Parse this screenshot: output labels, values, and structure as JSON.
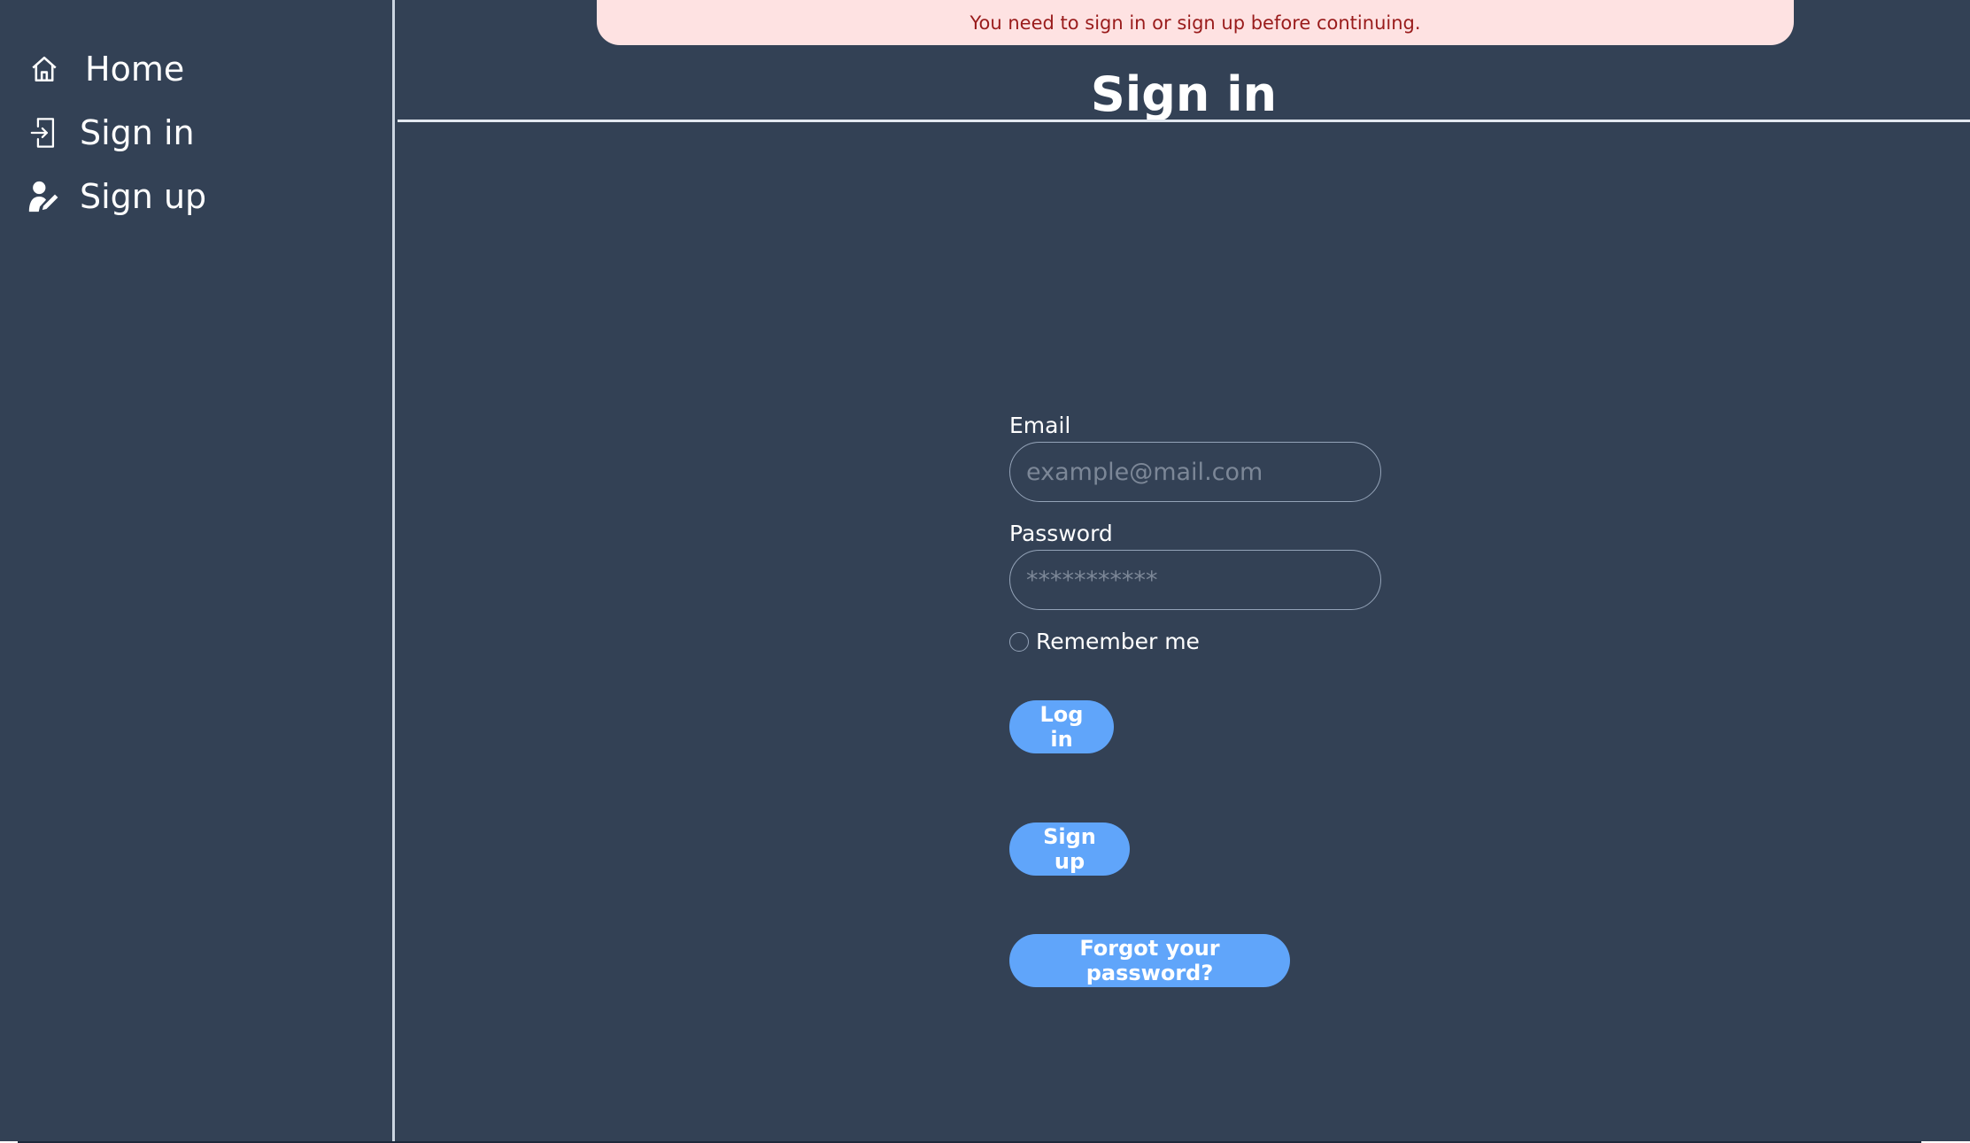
{
  "flash": {
    "message": "You need to sign in or sign up before continuing."
  },
  "sidebar": {
    "items": [
      {
        "label": "Home",
        "icon": "home-icon"
      },
      {
        "label": "Sign in",
        "icon": "sign-in-icon"
      },
      {
        "label": "Sign up",
        "icon": "user-edit-icon"
      }
    ]
  },
  "page": {
    "title": "Sign in"
  },
  "form": {
    "email_label": "Email",
    "email_placeholder": "example@mail.com",
    "email_value": "",
    "password_label": "Password",
    "password_placeholder": "***********",
    "password_value": "",
    "remember_label": "Remember me",
    "remember_checked": false,
    "login_button": "Log in",
    "signup_button": "Sign up",
    "forgot_button": "Forgot your password?"
  },
  "colors": {
    "background": "#334155",
    "accent": "#60a5fa",
    "flash_bg": "#fee2e2",
    "flash_text": "#991b1b"
  }
}
